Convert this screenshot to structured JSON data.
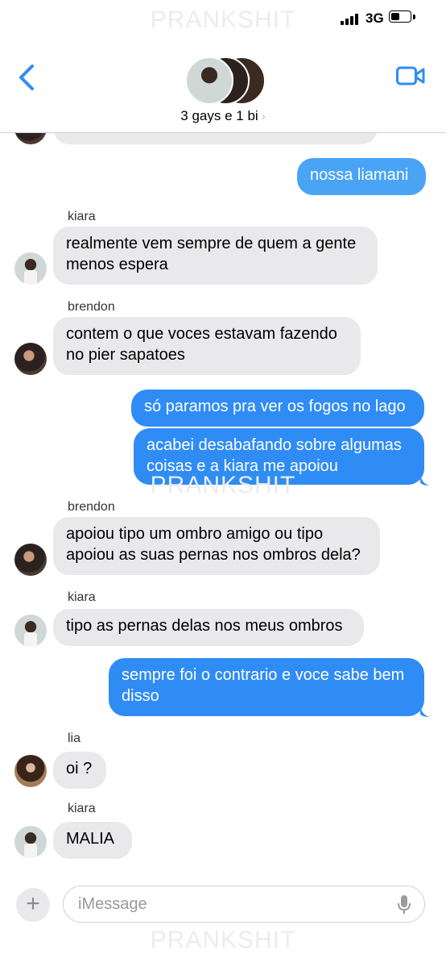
{
  "watermark": "PRANKSHIT",
  "status_bar": {
    "network": "3G",
    "battery_level": 0.45
  },
  "header": {
    "group_name": "3 gays e 1 bi",
    "chevron": "›"
  },
  "messages": [
    {
      "side": "in",
      "sender": "",
      "text": ""
    },
    {
      "side": "out",
      "text": "nossa liamani"
    },
    {
      "side": "in",
      "sender": "kiara",
      "text_lines": [
        "realmente vem sempre de quem a gente",
        "menos espera"
      ]
    },
    {
      "side": "in",
      "sender": "brendon",
      "text_lines": [
        "contem o que voces estavam fazendo",
        "no pier sapatoes"
      ]
    },
    {
      "side": "out",
      "text": "só paramos pra ver os fogos no lago"
    },
    {
      "side": "out",
      "text_lines": [
        "acabei desabafando sobre algumas",
        "coisas e a kiara me apoiou"
      ]
    },
    {
      "side": "in",
      "sender": "brendon",
      "text_lines": [
        "apoiou tipo um ombro amigo ou tipo",
        "apoiou as suas pernas nos ombros dela?"
      ]
    },
    {
      "side": "in",
      "sender": "kiara",
      "text": "tipo as pernas delas nos meus ombros"
    },
    {
      "side": "out",
      "text_lines": [
        "sempre foi o contrario e voce sabe bem",
        "disso"
      ]
    },
    {
      "side": "in",
      "sender": "lia",
      "text": "oi ?"
    },
    {
      "side": "in",
      "sender": "kiara",
      "text": "MALIA"
    }
  ],
  "compose": {
    "plus": "+",
    "placeholder": "iMessage"
  },
  "colors": {
    "accent": "#2f8cf5",
    "incoming": "#e9e9eb",
    "back": "#2f8cf5"
  },
  "icons": [
    "back-chevron-icon",
    "video-camera-icon",
    "microphone-icon",
    "plus-icon"
  ]
}
